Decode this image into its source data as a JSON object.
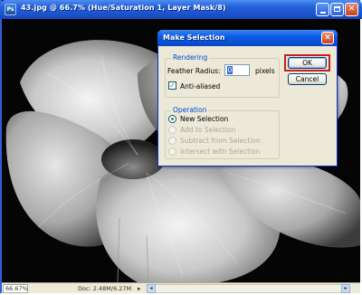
{
  "window": {
    "title": "43.jpg @ 66.7% (Hue/Saturation 1, Layer Mask/8)",
    "app_icon": "Ps"
  },
  "statusbar": {
    "zoom": "66.67%",
    "doc_info": "Doc: 2.48M/6.27M"
  },
  "dialog": {
    "title": "Make Selection",
    "rendering": {
      "legend": "Rendering",
      "feather_label": "Feather Radius:",
      "feather_value": "0",
      "feather_unit": "pixels",
      "anti_aliased_label": "Anti-aliased",
      "anti_aliased_checked": true
    },
    "operation": {
      "legend": "Operation",
      "options": [
        {
          "label": "New Selection",
          "selected": true,
          "enabled": true
        },
        {
          "label": "Add to Selection",
          "selected": false,
          "enabled": false
        },
        {
          "label": "Subtract from Selection",
          "selected": false,
          "enabled": false
        },
        {
          "label": "Intersect with Selection",
          "selected": false,
          "enabled": false
        }
      ]
    },
    "buttons": {
      "ok": "OK",
      "cancel": "Cancel"
    }
  },
  "colors": {
    "titlebar_blue": "#2460da",
    "dialog_face": "#ece9d8",
    "highlight_red": "#c81e1e",
    "legend_blue": "#0046d5"
  }
}
